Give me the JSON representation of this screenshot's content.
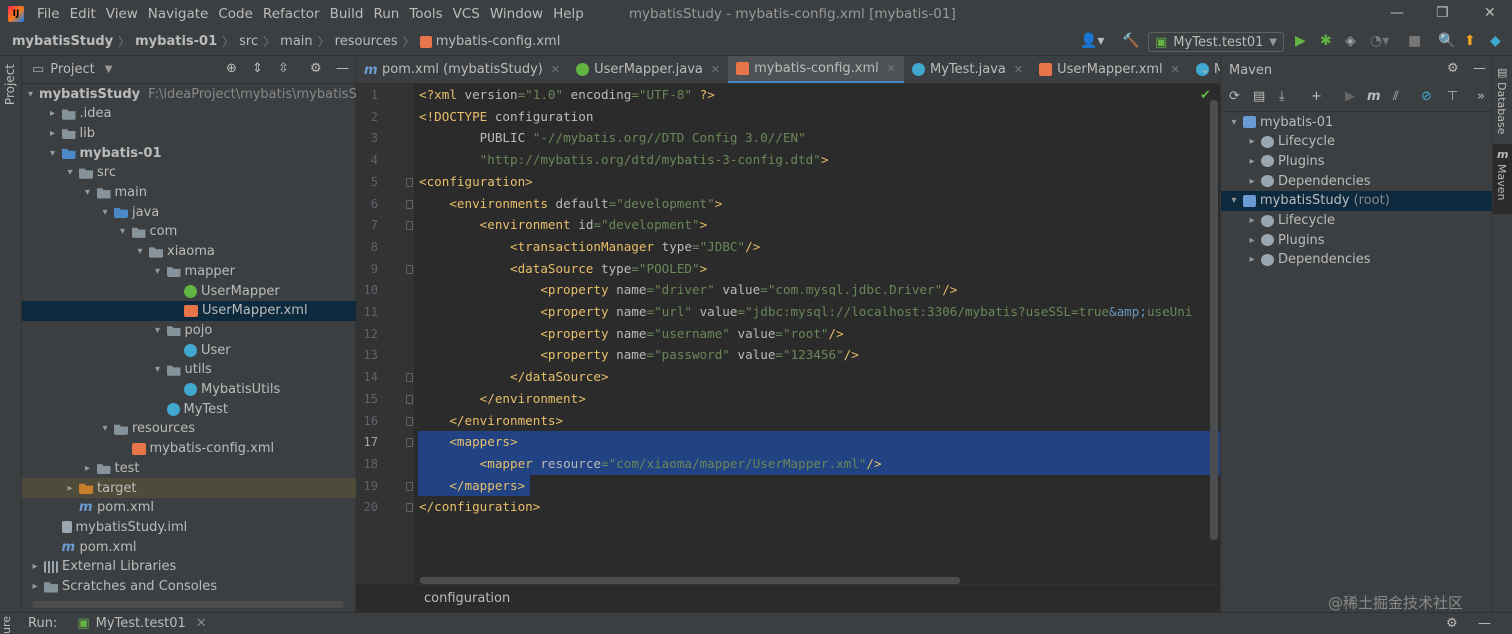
{
  "menu": [
    "File",
    "Edit",
    "View",
    "Navigate",
    "Code",
    "Refactor",
    "Build",
    "Run",
    "Tools",
    "VCS",
    "Window",
    "Help"
  ],
  "window_title": "mybatisStudy - mybatis-config.xml [mybatis-01]",
  "breadcrumb": [
    "mybatisStudy",
    "mybatis-01",
    "src",
    "main",
    "resources",
    "mybatis-config.xml"
  ],
  "run_config": "MyTest.test01",
  "project_panel": {
    "title": "Project",
    "tree": [
      {
        "label": "mybatisStudy",
        "path": "F:\\ideaProject\\mybatis\\mybatisStud",
        "icon": "module-icon",
        "level": 0,
        "arrow": "▾",
        "bold": true
      },
      {
        "label": ".idea",
        "icon": "folder-icon",
        "level": 1,
        "arrow": "▸"
      },
      {
        "label": "lib",
        "icon": "folder-icon",
        "level": 1,
        "arrow": "▸"
      },
      {
        "label": "mybatis-01",
        "icon": "module-icon",
        "level": 1,
        "arrow": "▾",
        "bold": true
      },
      {
        "label": "src",
        "icon": "folder-icon",
        "level": 2,
        "arrow": "▾"
      },
      {
        "label": "main",
        "icon": "folder-icon",
        "level": 3,
        "arrow": "▾"
      },
      {
        "label": "java",
        "icon": "source-folder-icon",
        "level": 4,
        "arrow": "▾"
      },
      {
        "label": "com",
        "icon": "package-icon",
        "level": 5,
        "arrow": "▾"
      },
      {
        "label": "xiaoma",
        "icon": "package-icon",
        "level": 6,
        "arrow": "▾"
      },
      {
        "label": "mapper",
        "icon": "package-icon",
        "level": 7,
        "arrow": "▾"
      },
      {
        "label": "UserMapper",
        "icon": "interface-icon",
        "level": 8,
        "arrow": ""
      },
      {
        "label": "UserMapper.xml",
        "icon": "xml-file-icon",
        "level": 8,
        "arrow": "",
        "selected": true
      },
      {
        "label": "pojo",
        "icon": "package-icon",
        "level": 7,
        "arrow": "▾"
      },
      {
        "label": "User",
        "icon": "class-icon",
        "level": 8,
        "arrow": ""
      },
      {
        "label": "utils",
        "icon": "package-icon",
        "level": 7,
        "arrow": "▾"
      },
      {
        "label": "MybatisUtils",
        "icon": "class-icon",
        "level": 8,
        "arrow": ""
      },
      {
        "label": "MyTest",
        "icon": "class-icon",
        "level": 7,
        "arrow": ""
      },
      {
        "label": "resources",
        "icon": "resources-folder-icon",
        "level": 4,
        "arrow": "▾"
      },
      {
        "label": "mybatis-config.xml",
        "icon": "xml-file-icon",
        "level": 5,
        "arrow": ""
      },
      {
        "label": "test",
        "icon": "folder-icon",
        "level": 3,
        "arrow": "▸"
      },
      {
        "label": "target",
        "icon": "excluded-folder-icon",
        "level": 2,
        "arrow": "▸",
        "excluded": true
      },
      {
        "label": "pom.xml",
        "icon": "maven-icon",
        "level": 2,
        "arrow": ""
      },
      {
        "label": "mybatisStudy.iml",
        "icon": "iml-file-icon",
        "level": 1,
        "arrow": ""
      },
      {
        "label": "pom.xml",
        "icon": "maven-icon",
        "level": 1,
        "arrow": ""
      },
      {
        "label": "External Libraries",
        "icon": "library-icon",
        "level": 0,
        "arrow": "▸"
      },
      {
        "label": "Scratches and Consoles",
        "icon": "scratches-icon",
        "level": 0,
        "arrow": "▸"
      }
    ]
  },
  "tabs": [
    {
      "label": "pom.xml (mybatisStudy)",
      "icon": "maven-icon",
      "color": "#6b9bd2"
    },
    {
      "label": "UserMapper.java",
      "icon": "interface-icon",
      "color": "#62b543"
    },
    {
      "label": "mybatis-config.xml",
      "icon": "xml-file-icon",
      "color": "#e8754a",
      "active": true
    },
    {
      "label": "MyTest.java",
      "icon": "class-icon",
      "color": "#40a8cf"
    },
    {
      "label": "UserMapper.xml",
      "icon": "xml-file-icon",
      "color": "#e8754a"
    },
    {
      "label": "MybatisU",
      "icon": "class-icon",
      "color": "#40a8cf"
    }
  ],
  "code_lines": [
    [
      [
        "t-tag",
        "<?xml "
      ],
      [
        "t-attr",
        "version"
      ],
      [
        "t-val",
        "=\"1.0\" "
      ],
      [
        "t-attr",
        "encoding"
      ],
      [
        "t-val",
        "=\"UTF-8\""
      ],
      [
        "t-tag",
        " ?>"
      ]
    ],
    [
      [
        "t-tag",
        "<!DOCTYPE "
      ],
      [
        "t-attr",
        "configuration"
      ]
    ],
    [
      [
        "t-attr",
        "        PUBLIC "
      ],
      [
        "t-val",
        "\"-//mybatis.org//DTD Config 3.0//EN\""
      ]
    ],
    [
      [
        "t-val",
        "        \"http://mybatis.org/dtd/mybatis-3-config.dtd\""
      ],
      [
        "t-tag",
        ">"
      ]
    ],
    [
      [
        "t-tag",
        "<configuration>"
      ]
    ],
    [
      [
        "t-tag",
        "    <environments "
      ],
      [
        "t-attr",
        "default"
      ],
      [
        "t-val",
        "=\"development\""
      ],
      [
        "t-tag",
        ">"
      ]
    ],
    [
      [
        "t-tag",
        "        <environment "
      ],
      [
        "t-attr",
        "id"
      ],
      [
        "t-val",
        "=\"development\""
      ],
      [
        "t-tag",
        ">"
      ]
    ],
    [
      [
        "t-tag",
        "            <transactionManager "
      ],
      [
        "t-attr",
        "type"
      ],
      [
        "t-val",
        "=\"JDBC\""
      ],
      [
        "t-tag",
        "/>"
      ]
    ],
    [
      [
        "t-tag",
        "            <dataSource "
      ],
      [
        "t-attr",
        "type"
      ],
      [
        "t-val",
        "=\"POOLED\""
      ],
      [
        "t-tag",
        ">"
      ]
    ],
    [
      [
        "t-tag",
        "                <property "
      ],
      [
        "t-attr",
        "name"
      ],
      [
        "t-val",
        "=\"driver\" "
      ],
      [
        "t-attr",
        "value"
      ],
      [
        "t-val",
        "=\"com.mysql.jdbc.Driver\""
      ],
      [
        "t-tag",
        "/>"
      ]
    ],
    [
      [
        "t-tag",
        "                <property "
      ],
      [
        "t-attr",
        "name"
      ],
      [
        "t-val",
        "=\"url\" "
      ],
      [
        "t-attr",
        "value"
      ],
      [
        "t-val",
        "=\"jdbc:mysql://localhost:3306/mybatis?useSSL=true"
      ],
      [
        "t-ent",
        "&amp;"
      ],
      [
        "t-val",
        "useUni"
      ]
    ],
    [
      [
        "t-tag",
        "                <property "
      ],
      [
        "t-attr",
        "name"
      ],
      [
        "t-val",
        "=\"username\" "
      ],
      [
        "t-attr",
        "value"
      ],
      [
        "t-val",
        "=\"root\""
      ],
      [
        "t-tag",
        "/>"
      ]
    ],
    [
      [
        "t-tag",
        "                <property "
      ],
      [
        "t-attr",
        "name"
      ],
      [
        "t-val",
        "=\"password\" "
      ],
      [
        "t-attr",
        "value"
      ],
      [
        "t-val",
        "=\"123456\""
      ],
      [
        "t-tag",
        "/>"
      ]
    ],
    [
      [
        "t-tag",
        "            </dataSource>"
      ]
    ],
    [
      [
        "t-tag",
        "        </environment>"
      ]
    ],
    [
      [
        "t-tag",
        "    </environments>"
      ]
    ],
    [
      [
        "t-tag",
        "    <mappers>"
      ]
    ],
    [
      [
        "t-tag",
        "        <mapper "
      ],
      [
        "t-attr",
        "resource"
      ],
      [
        "t-val",
        "=\"com/xiaoma/mapper/UserMapper.xml\""
      ],
      [
        "t-tag",
        "/>"
      ]
    ],
    [
      [
        "t-tag",
        "    </mappers>"
      ]
    ],
    [
      [
        "t-tag",
        "</configuration>"
      ]
    ]
  ],
  "selected_lines": [
    17,
    18,
    19
  ],
  "current_line": 17,
  "editor_breadcrumb": "configuration",
  "maven": {
    "title": "Maven",
    "tree": [
      {
        "label": "mybatis-01",
        "level": 0,
        "arrow": "▾",
        "icon": "maven-module-icon"
      },
      {
        "label": "Lifecycle",
        "level": 1,
        "arrow": "▸",
        "icon": "lifecycle-icon"
      },
      {
        "label": "Plugins",
        "level": 1,
        "arrow": "▸",
        "icon": "plugins-icon"
      },
      {
        "label": "Dependencies",
        "level": 1,
        "arrow": "▸",
        "icon": "dependencies-icon"
      },
      {
        "label": "mybatisStudy",
        "suffix": "(root)",
        "level": 0,
        "arrow": "▾",
        "icon": "maven-module-icon",
        "selected": true
      },
      {
        "label": "Lifecycle",
        "level": 1,
        "arrow": "▸",
        "icon": "lifecycle-icon"
      },
      {
        "label": "Plugins",
        "level": 1,
        "arrow": "▸",
        "icon": "plugins-icon"
      },
      {
        "label": "Dependencies",
        "level": 1,
        "arrow": "▸",
        "icon": "dependencies-icon"
      }
    ]
  },
  "right_strip": [
    "Database",
    "Maven"
  ],
  "left_strip": "Project",
  "bottom": {
    "run_label": "Run:",
    "run_target": "MyTest.test01",
    "side_label": "ure"
  },
  "watermark": "@稀土掘金技术社区"
}
